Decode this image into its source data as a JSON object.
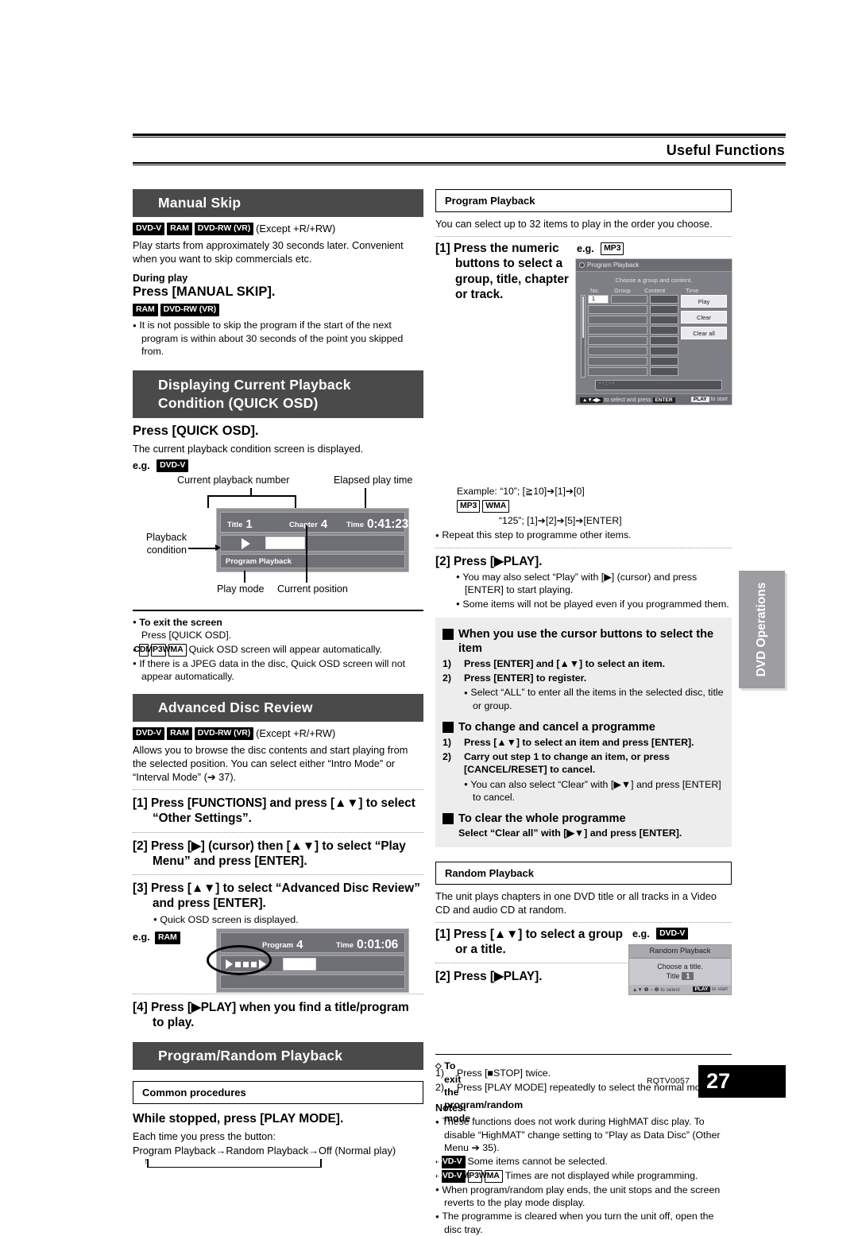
{
  "header": {
    "title": "Useful Functions"
  },
  "side_tab": {
    "label": "DVD Operations"
  },
  "footer": {
    "code": "RQTV0057",
    "page": "27"
  },
  "left": {
    "manual_skip": {
      "banner": "Manual Skip",
      "badges": [
        "DVD-V",
        "RAM",
        "DVD-RW (VR)"
      ],
      "badge_note": "(Except +R/+RW)",
      "body": "Play starts from approximately 30 seconds later. Convenient when you want to skip commercials etc.",
      "during_play": "During play",
      "press": "Press [MANUAL SKIP].",
      "badges2": [
        "RAM",
        "DVD-RW (VR)"
      ],
      "bullets": [
        "It is not possible to skip the program if the start of the next program is within about 30 seconds of the point you skipped from."
      ]
    },
    "quick_osd": {
      "banner_line1": "Displaying Current Playback",
      "banner_line2": "Condition (QUICK OSD)",
      "press": "Press [QUICK OSD].",
      "body": "The current playback condition screen is displayed.",
      "eg_label": "e.g.",
      "eg_badge": "DVD-V",
      "callouts": {
        "current_playback_number": "Current playback number",
        "elapsed_play_time": "Elapsed play time",
        "playback_condition_l1": "Playback",
        "playback_condition_l2": "condition",
        "play_mode": "Play mode",
        "current_position": "Current position"
      },
      "osd": {
        "title_label": "Title",
        "title_value": "1",
        "chapter_label": "Chapter",
        "chapter_value": "4",
        "time_label": "Time",
        "time_value": "0:41:23",
        "play_mode_text": "Program Playback"
      },
      "exit_head": "To exit the screen",
      "exit_body": "Press [QUICK OSD].",
      "bullets": [
        {
          "badges": [
            "CD",
            "MP3",
            "WMA"
          ],
          "text": "Quick OSD screen will appear automatically."
        },
        {
          "badges": [],
          "text": "If there is a JPEG data in the disc, Quick OSD screen will not appear automatically."
        }
      ]
    },
    "advanced_disc_review": {
      "banner": "Advanced Disc Review",
      "badges": [
        "DVD-V",
        "RAM",
        "DVD-RW (VR)"
      ],
      "badge_note": "(Except +R/+RW)",
      "body": "Allows you to browse the disc contents and start playing from the selected position. You can select either “Intro Mode” or “Interval Mode” (➔ 37).",
      "steps": [
        "[1] Press [FUNCTIONS] and press [▲▼] to select “Other Settings”.",
        "[2] Press [▶] (cursor) then [▲▼] to select “Play Menu” and press [ENTER].",
        "[3] Press [▲▼] to select “Advanced Disc Review” and press [ENTER]."
      ],
      "step3_bullet": "Quick OSD screen is displayed.",
      "eg_label": "e.g.",
      "eg_badge": "RAM",
      "osd": {
        "program_label": "Program",
        "program_value": "4",
        "time_label": "Time",
        "time_value": "0:01:06"
      },
      "step4": "[4] Press [▶PLAY] when you find a title/program to play."
    },
    "program_random": {
      "banner": "Program/Random Playback",
      "box_head": "Common procedures",
      "press": "While stopped, press [PLAY MODE].",
      "body": "Each time you press the button:",
      "cycle": "Program Playback→Random Playback→Off (Normal play)"
    }
  },
  "right": {
    "program_playback": {
      "box_head": "Program Playback",
      "intro": "You can select up to 32 items to play in the order you choose.",
      "step1": "[1] Press the numeric buttons to select a group, title, chapter or track.",
      "eg_label": "e.g.",
      "eg_badge": "MP3",
      "screen": {
        "title": "Program Playback",
        "subtitle": "Choose a group and content.",
        "columns": [
          "No.",
          "Group",
          "Content",
          "Time"
        ],
        "first_row_no": "1",
        "buttons": [
          "Play",
          "Clear",
          "Clear all"
        ],
        "bottom_value": "- - : - -",
        "foot_left_keys": "▲▼◀▶",
        "foot_left_text": "to select and press",
        "foot_left_key2": "ENTER",
        "foot_right_key": "PLAY",
        "foot_right_text": "to start"
      },
      "example_line1": "Example: “10”;  [≧10]➔[1]➔[0]",
      "example_badges": [
        "MP3",
        "WMA"
      ],
      "example_line2": "“125”; [1]➔[2]➔[5]➔[ENTER]",
      "example_bullet": "Repeat this step to programme other items.",
      "step2": "[2] Press [▶PLAY].",
      "step2_bullets": [
        "You may also select “Play” with [▶] (cursor) and press [ENTER] to start playing.",
        "Some items will not be played even if you programmed them."
      ],
      "cursor_head": "When you use the cursor buttons to select the item",
      "cursor_steps": [
        "Press [ENTER] and [▲▼] to select an item.",
        "Press [ENTER] to register."
      ],
      "cursor_bullet": "Select “ALL” to enter all the items in the selected disc, title or group.",
      "change_head": "To change and cancel a programme",
      "change_steps": [
        "Press [▲▼] to select an item and press [ENTER].",
        "Carry out step 1 to change an item, or press [CANCEL/RESET] to cancel."
      ],
      "change_bullet": "You can also select “Clear” with [▶▼] and press [ENTER] to cancel.",
      "clear_head": "To clear the whole programme",
      "clear_body": "Select “Clear all” with [▶▼] and press [ENTER]."
    },
    "random_playback": {
      "box_head": "Random Playback",
      "intro": "The unit plays chapters in one DVD title or all tracks in a Video CD and audio CD at random.",
      "step1": "[1] Press [▲▼] to select a group or a title.",
      "step2": "[2] Press [▶PLAY].",
      "eg_label": "e.g.",
      "eg_badge": "DVD-V",
      "screen": {
        "title": "Random Playback",
        "line1": "Choose a title.",
        "line2_label": "Title",
        "line2_value": "1",
        "foot_left": "▲▼ ❶ – ❷ to select",
        "foot_right_key": "PLAY",
        "foot_right_text": "to start"
      },
      "exit_head": "To exit the program/random mode",
      "exit_steps": [
        "Press [■STOP] twice.",
        "Press [PLAY MODE] repeatedly to select the normal mode."
      ],
      "notes_head": "Notes:",
      "notes": [
        {
          "badges": [],
          "text": "These functions does not work during HighMAT disc play. To disable “HighMAT” change setting to “Play as Data Disc” (Other Menu ➔ 35)."
        },
        {
          "badges": [
            "DVD-V"
          ],
          "text": "Some items cannot be selected."
        },
        {
          "badges": [
            "DVD-V",
            "MP3",
            "WMA"
          ],
          "text": "Times are not displayed while programming."
        },
        {
          "badges": [],
          "text": "When program/random play ends, the unit stops and the screen reverts to the play mode display."
        },
        {
          "badges": [],
          "text": "The programme is cleared when you turn the unit off, open the disc tray."
        }
      ]
    }
  }
}
